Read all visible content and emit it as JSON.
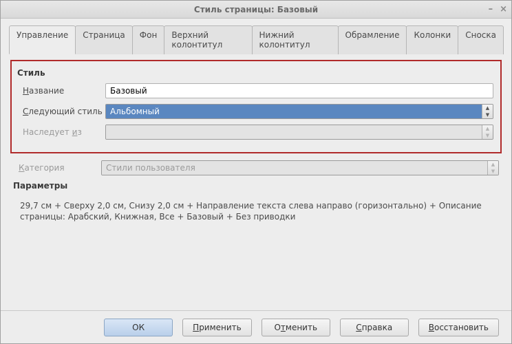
{
  "window": {
    "title": "Стиль страницы: Базовый"
  },
  "tabs": {
    "t0": "Управление",
    "t1": "Страница",
    "t2": "Фон",
    "t3": "Верхний колонтитул",
    "t4": "Нижний колонтитул",
    "t5": "Обрамление",
    "t6": "Колонки",
    "t7": "Сноска"
  },
  "group": {
    "style_header": "Стиль",
    "name_label": "Название",
    "name_value": "Базовый",
    "next_label": "Следующий стиль",
    "next_value": "Альбомный",
    "inherit_label": "Наследует из",
    "inherit_value": "",
    "category_label": "Категория",
    "category_value": "Стили пользователя"
  },
  "params": {
    "header": "Параметры",
    "text": "29,7 см + Сверху 2,0 см, Снизу 2,0 см + Направление текста слева направо (горизонтально) + Описание страницы: Арабский, Книжная, Все + Базовый + Без приводки"
  },
  "buttons": {
    "ok": "ОК",
    "apply": "Применить",
    "cancel": "Отменить",
    "help": "Справка",
    "reset": "Восстановить"
  }
}
